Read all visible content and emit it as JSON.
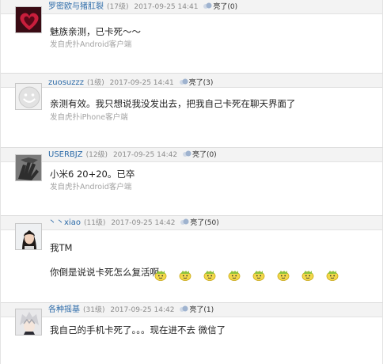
{
  "colors": {
    "username": "#2b6aa8",
    "meta": "#8c8c8c",
    "header_bg": "#f3f3f3",
    "source": "#a3a3a3"
  },
  "posts": [
    {
      "username": "罗密欧与猪肛裂",
      "level": "(17级)",
      "time": "2017-09-25 14:41",
      "light": "亮了(0)",
      "lines": [
        "魅族亲测，已卡死～～"
      ],
      "source": "发自虎扑Android客户端",
      "avatar_icon": "heart-avatar-icon"
    },
    {
      "username": "zuosuzzz",
      "level": "(1级)",
      "time": "2017-09-25 14:41",
      "light": "亮了(3)",
      "lines": [
        "亲测有效。我只想说我没发出去，把我自己卡死在聊天界面了"
      ],
      "source": "发自虎扑iPhone客户端",
      "avatar_icon": "smiley-avatar-icon"
    },
    {
      "username": "USERBJZ",
      "level": "(12级)",
      "time": "2017-09-25 14:42",
      "light": "亮了(0)",
      "lines": [
        "小米6 20+20。已卒"
      ],
      "source": "发自虎扑Android客户端",
      "avatar_icon": "hands-avatar-icon"
    },
    {
      "username": "丶丶xiao",
      "level": "(11级)",
      "time": "2017-09-25 14:42",
      "light": "亮了(50)",
      "lines": [
        "我TM",
        "你倒是说说卡死怎么复活啊"
      ],
      "emoji_count": 8,
      "avatar_icon": "person-avatar-icon"
    },
    {
      "username": "各种摇基",
      "level": "(31级)",
      "time": "2017-09-25 14:42",
      "light": "亮了(1)",
      "lines": [
        "我自己的手机卡死了。。。现在进不去 微信了"
      ],
      "avatar_icon": "anime-avatar-icon"
    }
  ]
}
